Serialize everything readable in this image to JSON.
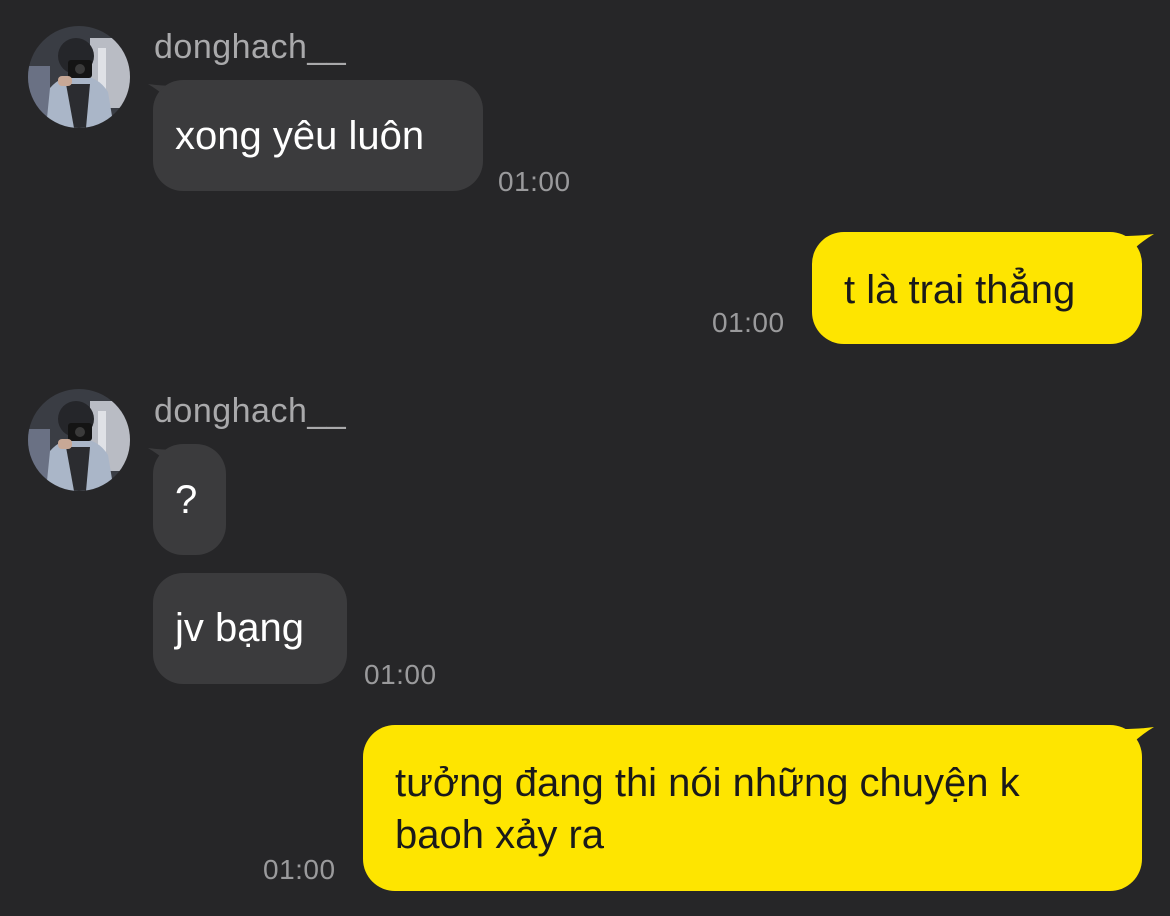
{
  "conversation": {
    "groups": [
      {
        "sender": "donghach__",
        "messages": [
          {
            "text": "xong yêu luôn",
            "time": "01:00"
          }
        ]
      },
      {
        "self": true,
        "messages": [
          {
            "text": "t là trai thẳng",
            "time": "01:00"
          }
        ]
      },
      {
        "sender": "donghach__",
        "messages": [
          {
            "text": "?"
          },
          {
            "text": "jv bạng",
            "time": "01:00"
          }
        ]
      },
      {
        "self": true,
        "messages": [
          {
            "line1": "tưởng đang thi nói những chuyện k",
            "line2": "baoh xảy ra",
            "time": "01:00"
          }
        ]
      }
    ]
  },
  "theme": {
    "background": "#262628",
    "incoming_bubble": "#3b3b3d",
    "outgoing_bubble": "#fee500",
    "timestamp_color": "#9a9a9c"
  }
}
